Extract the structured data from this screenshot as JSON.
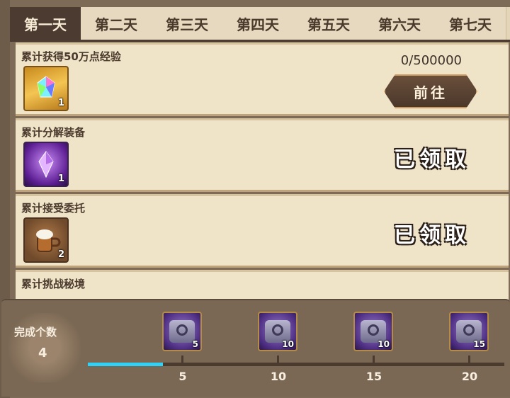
{
  "tabs": [
    {
      "label": "第一天",
      "active": true
    },
    {
      "label": "第二天",
      "active": false
    },
    {
      "label": "第三天",
      "active": false
    },
    {
      "label": "第四天",
      "active": false
    },
    {
      "label": "第五天",
      "active": false
    },
    {
      "label": "第六天",
      "active": false
    },
    {
      "label": "第七天",
      "active": false
    }
  ],
  "tasks": [
    {
      "title": "累计获得50万点经验",
      "item_icon": "rainbow-crystal-icon",
      "item_qty": "1",
      "progress": "0/500000",
      "action_label": "前往"
    },
    {
      "title": "累计分解装备",
      "item_icon": "purple-crystal-icon",
      "item_qty": "1",
      "status": "已领取"
    },
    {
      "title": "累计接受委托",
      "item_icon": "beer-mug-icon",
      "item_qty": "2",
      "status": "已领取"
    },
    {
      "title": "累计挑战秘境"
    }
  ],
  "completion": {
    "label": "完成个数",
    "count": "4",
    "progress_fraction": 0.18
  },
  "rewards": [
    {
      "qty": "5",
      "milestone": "5",
      "icon": "cube-chest-icon"
    },
    {
      "qty": "10",
      "milestone": "10",
      "icon": "cube-chest-icon"
    },
    {
      "qty": "10",
      "milestone": "15",
      "icon": "cube-chest-icon"
    },
    {
      "qty": "15",
      "milestone": "20",
      "icon": "cube-chest-icon"
    }
  ],
  "colors": {
    "accent": "#2fd1f6",
    "tab_active": "#4b3b31",
    "panel": "#efe3c8"
  }
}
